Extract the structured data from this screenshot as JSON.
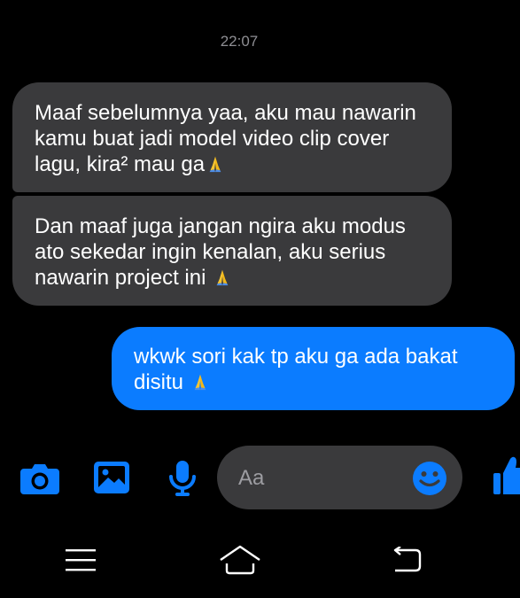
{
  "chat": {
    "timestamp": "22:07",
    "messages": [
      {
        "side": "incoming",
        "text": "Maaf sebelumnya yaa, aku mau nawarin kamu buat jadi model video clip cover lagu, kira² mau ga",
        "emoji": "folded-hands"
      },
      {
        "side": "incoming",
        "text": "Dan maaf juga jangan ngira aku modus ato sekedar ingin kenalan, aku serius nawarin project ini ",
        "emoji": "folded-hands"
      },
      {
        "side": "outgoing",
        "text": "wkwk sori kak tp aku ga ada bakat disitu ",
        "emoji": "folded-hands"
      }
    ]
  },
  "composer": {
    "placeholder": "Aa",
    "tools": [
      "camera-icon",
      "gallery-icon",
      "microphone-icon"
    ],
    "emoji_button": "smiley-icon",
    "send_button": "thumbs-up-icon"
  },
  "navigation": {
    "buttons": [
      "menu-icon",
      "home-icon",
      "back-icon"
    ]
  },
  "colors": {
    "background": "#000000",
    "incoming_bubble": "#3a3a3c",
    "outgoing_bubble": "#0b7cff",
    "accent": "#0b7cff",
    "timestamp": "#8e8e93"
  }
}
